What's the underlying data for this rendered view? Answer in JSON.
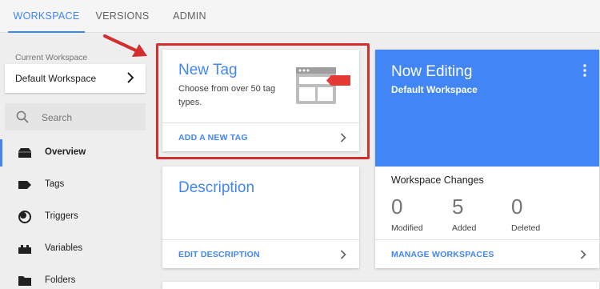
{
  "tabs": [
    {
      "label": "WORKSPACE",
      "active": true
    },
    {
      "label": "VERSIONS",
      "active": false
    },
    {
      "label": "ADMIN",
      "active": false
    }
  ],
  "sidebar": {
    "current_workspace_label": "Current Workspace",
    "current_workspace_value": "Default Workspace",
    "search_placeholder": "Search",
    "items": [
      {
        "label": "Overview",
        "icon": "overview-icon",
        "active": true
      },
      {
        "label": "Tags",
        "icon": "tag-icon",
        "active": false
      },
      {
        "label": "Triggers",
        "icon": "trigger-icon",
        "active": false
      },
      {
        "label": "Variables",
        "icon": "variables-icon",
        "active": false
      },
      {
        "label": "Folders",
        "icon": "folder-icon",
        "active": false
      }
    ]
  },
  "new_tag_card": {
    "title": "New Tag",
    "description": "Choose from over 50 tag types.",
    "action": "ADD A NEW TAG"
  },
  "description_card": {
    "title": "Description",
    "action": "EDIT DESCRIPTION"
  },
  "now_editing_card": {
    "title": "Now Editing",
    "workspace": "Default Workspace",
    "changes_label": "Workspace Changes",
    "stats": [
      {
        "value": "0",
        "label": "Modified"
      },
      {
        "value": "5",
        "label": "Added"
      },
      {
        "value": "0",
        "label": "Deleted"
      }
    ],
    "action": "MANAGE WORKSPACES"
  },
  "colors": {
    "accent": "#4285f4",
    "highlight": "#d32f2f",
    "tag_red": "#e53935"
  }
}
